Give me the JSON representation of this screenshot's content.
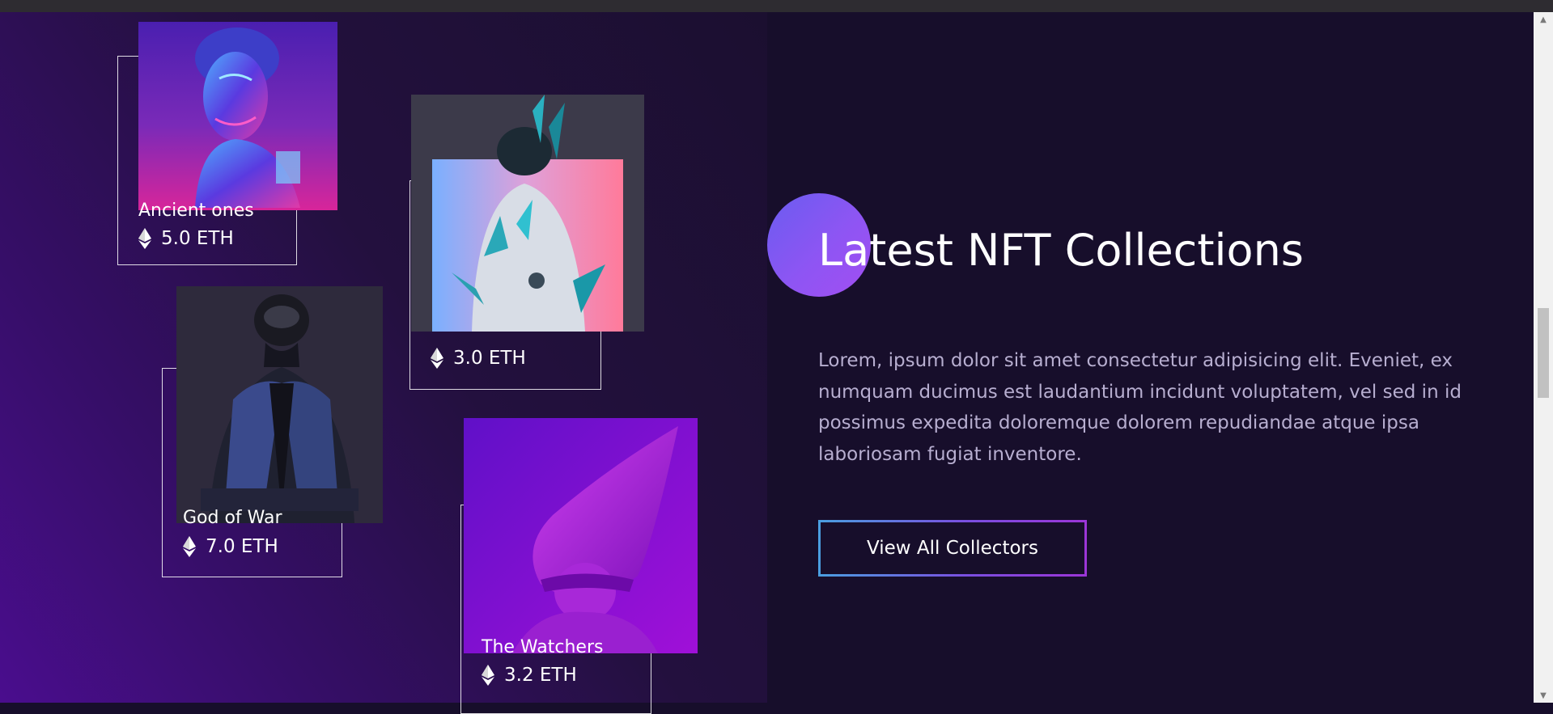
{
  "section": {
    "heading": "Latest NFT Collections",
    "description": "Lorem, ipsum dolor sit amet consectetur adipisicing elit. Eveniet, ex numquam ducimus est laudantium incidunt voluptatem, vel sed in id possimus expedita doloremque dolorem repudiandae atque ipsa laboriosam fugiat inventore.",
    "cta_label": "View All Collectors"
  },
  "cards": [
    {
      "name": "Ancient ones",
      "price": "5.0 ETH",
      "icon": "ethereum-icon"
    },
    {
      "name": "",
      "price": "3.0 ETH",
      "icon": "ethereum-icon"
    },
    {
      "name": "God of War",
      "price": "7.0 ETH",
      "icon": "ethereum-icon"
    },
    {
      "name": "The Watchers",
      "price": "3.2 ETH",
      "icon": "ethereum-icon"
    }
  ],
  "colors": {
    "accent_gradient_start": "#6a5cf0",
    "accent_gradient_end": "#a24ef2",
    "background": "#170e2b",
    "description_text": "#b7aed0"
  }
}
